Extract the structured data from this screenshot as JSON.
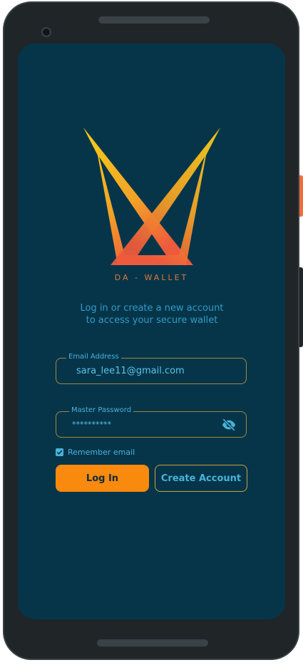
{
  "app": {
    "brand": "DA - WALLET",
    "subtitle_line1": "Log in or create a new account",
    "subtitle_line2": "to access your secure wallet"
  },
  "form": {
    "email": {
      "label": "Email Address",
      "value": "sara_lee11@gmail.com"
    },
    "password": {
      "label": "Master Password",
      "value": "**********",
      "visibility_icon": "eye-off-icon"
    },
    "remember": {
      "label": "Remember email",
      "checked": true
    }
  },
  "actions": {
    "login_label": "Log In",
    "create_label": "Create Account"
  },
  "colors": {
    "screen_bg": "#06354a",
    "accent_orange": "#f98a0d",
    "accent_blue": "#48b3d8",
    "logo_yellow": "#f5c518",
    "logo_red": "#ee5a3c"
  }
}
